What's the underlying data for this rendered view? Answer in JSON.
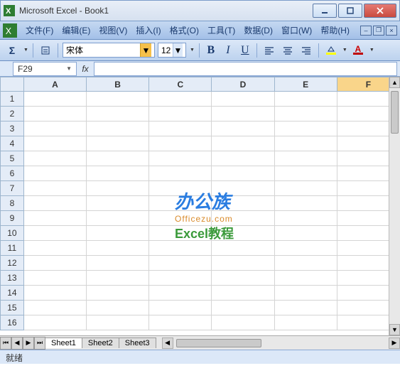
{
  "window": {
    "title": "Microsoft Excel - Book1"
  },
  "menu": {
    "file": "文件(F)",
    "edit": "编辑(E)",
    "view": "视图(V)",
    "insert": "插入(I)",
    "format": "格式(O)",
    "tools": "工具(T)",
    "data": "数据(D)",
    "window_m": "窗口(W)",
    "help": "帮助(H)"
  },
  "toolbar": {
    "font_name": "宋体",
    "font_size": "12"
  },
  "formula": {
    "name_box": "F29",
    "fx_label": "fx",
    "value": ""
  },
  "columns": [
    "A",
    "B",
    "C",
    "D",
    "E",
    "F"
  ],
  "rows": [
    "1",
    "2",
    "3",
    "4",
    "5",
    "6",
    "7",
    "8",
    "9",
    "10",
    "11",
    "12",
    "13",
    "14",
    "15",
    "16"
  ],
  "selected_column": "F",
  "watermark": {
    "line1": "办公族",
    "line2": "Officezu.com",
    "line3": "Excel教程"
  },
  "tabs": [
    "Sheet1",
    "Sheet2",
    "Sheet3"
  ],
  "status": "就绪"
}
